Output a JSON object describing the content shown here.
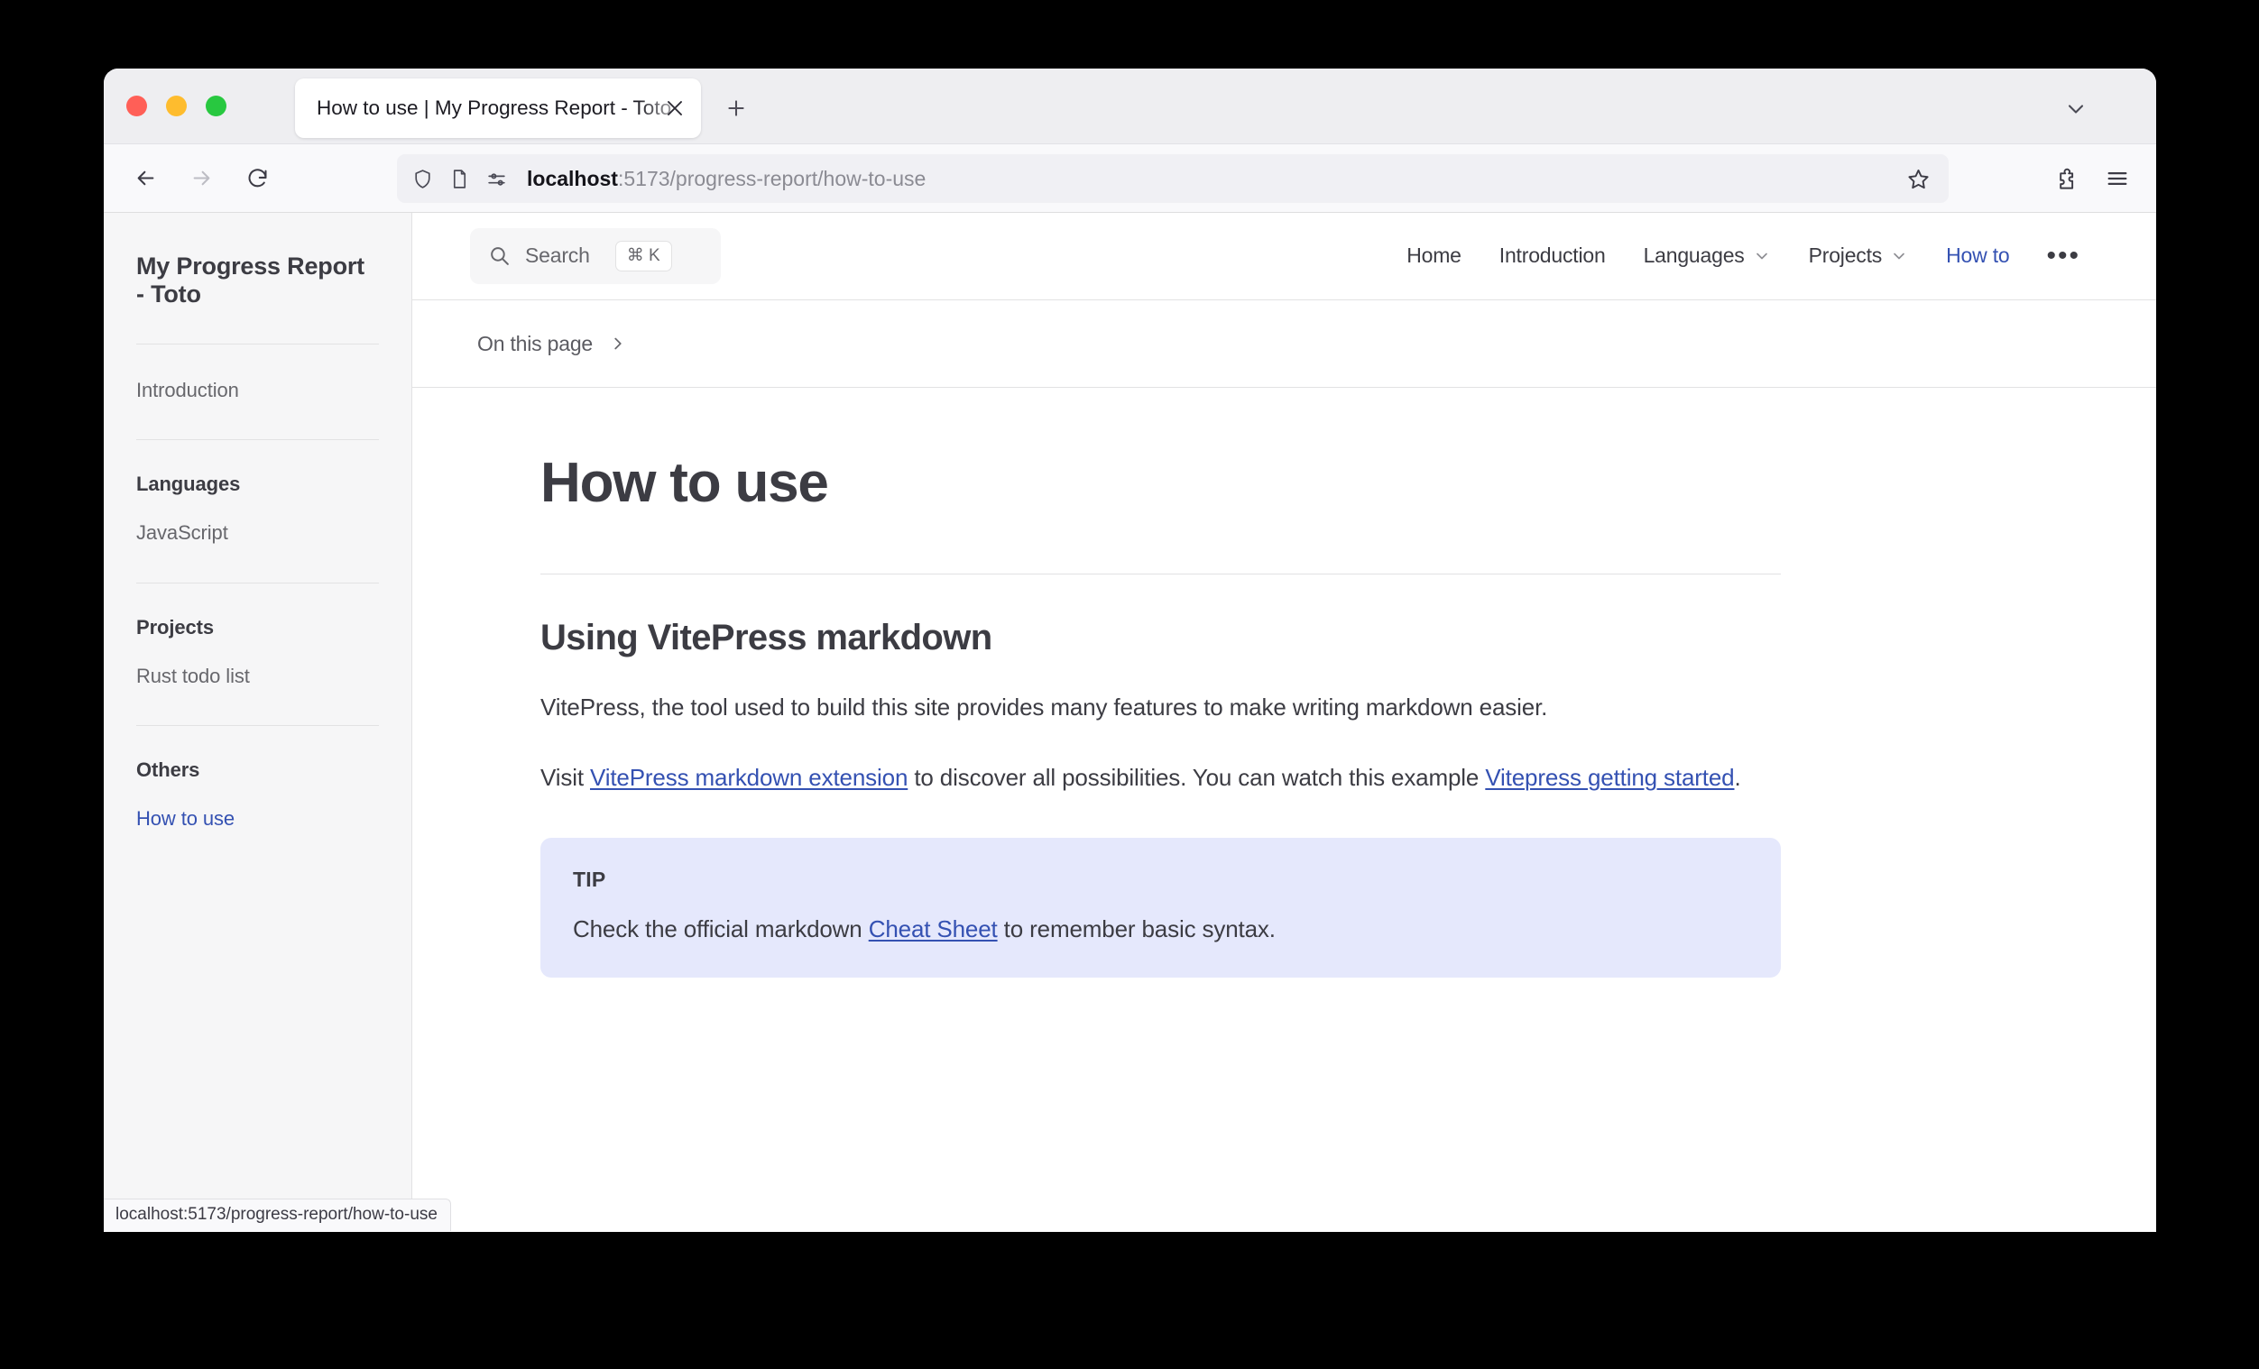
{
  "browser": {
    "tab": {
      "title": "How to use | My Progress Report - Toto",
      "close_icon": "close-icon"
    },
    "new_tab_label": "+",
    "url": {
      "host": "localhost",
      "path": ":5173/progress-report/how-to-use",
      "full": "localhost:5173/progress-report/how-to-use"
    },
    "status_url": "localhost:5173/progress-report/how-to-use",
    "icons": {
      "back": "back-arrow-icon",
      "forward": "forward-arrow-icon",
      "reload": "reload-icon",
      "shield": "shield-icon",
      "page": "page-icon",
      "permissions": "permissions-icon",
      "bookmark": "star-icon",
      "extensions": "puzzle-icon",
      "menu": "hamburger-menu-icon",
      "tab_list": "chevron-down-icon"
    }
  },
  "sidebar": {
    "site_title": "My Progress Report - Toto",
    "top_links": [
      {
        "label": "Introduction",
        "active": false
      }
    ],
    "groups": [
      {
        "title": "Languages",
        "items": [
          {
            "label": "JavaScript",
            "active": false
          }
        ]
      },
      {
        "title": "Projects",
        "items": [
          {
            "label": "Rust todo list",
            "active": false
          }
        ]
      },
      {
        "title": "Others",
        "items": [
          {
            "label": "How to use",
            "active": true
          }
        ]
      }
    ]
  },
  "topnav": {
    "search": {
      "placeholder": "Search",
      "shortcut": "⌘ K",
      "icon": "search-icon"
    },
    "links": [
      {
        "label": "Home",
        "has_chevron": false,
        "active": false
      },
      {
        "label": "Introduction",
        "has_chevron": false,
        "active": false
      },
      {
        "label": "Languages",
        "has_chevron": true,
        "active": false
      },
      {
        "label": "Projects",
        "has_chevron": true,
        "active": false
      },
      {
        "label": "How to",
        "has_chevron": false,
        "active": true
      }
    ],
    "more_label": "•••"
  },
  "outline": {
    "label": "On this page",
    "chevron": "chevron-right-icon"
  },
  "main": {
    "page_title": "How to use",
    "section_title": "Using VitePress markdown",
    "paragraph_1": "VitePress, the tool used to build this site provides many features to make writing markdown easier.",
    "paragraph_2": {
      "prefix": "Visit ",
      "link_1": "VitePress markdown extension",
      "middle": " to discover all possibilities. You can watch this example ",
      "link_2": "Vitepress getting started",
      "suffix": "."
    },
    "tip": {
      "title": "TIP",
      "prefix": "Check the official markdown ",
      "link": "Cheat Sheet",
      "suffix": " to remember basic syntax."
    }
  },
  "colors": {
    "accent": "#3451b2",
    "sidebar_bg": "#f6f6f7",
    "tip_bg": "#e5e8fc",
    "text": "#3c3c43"
  }
}
